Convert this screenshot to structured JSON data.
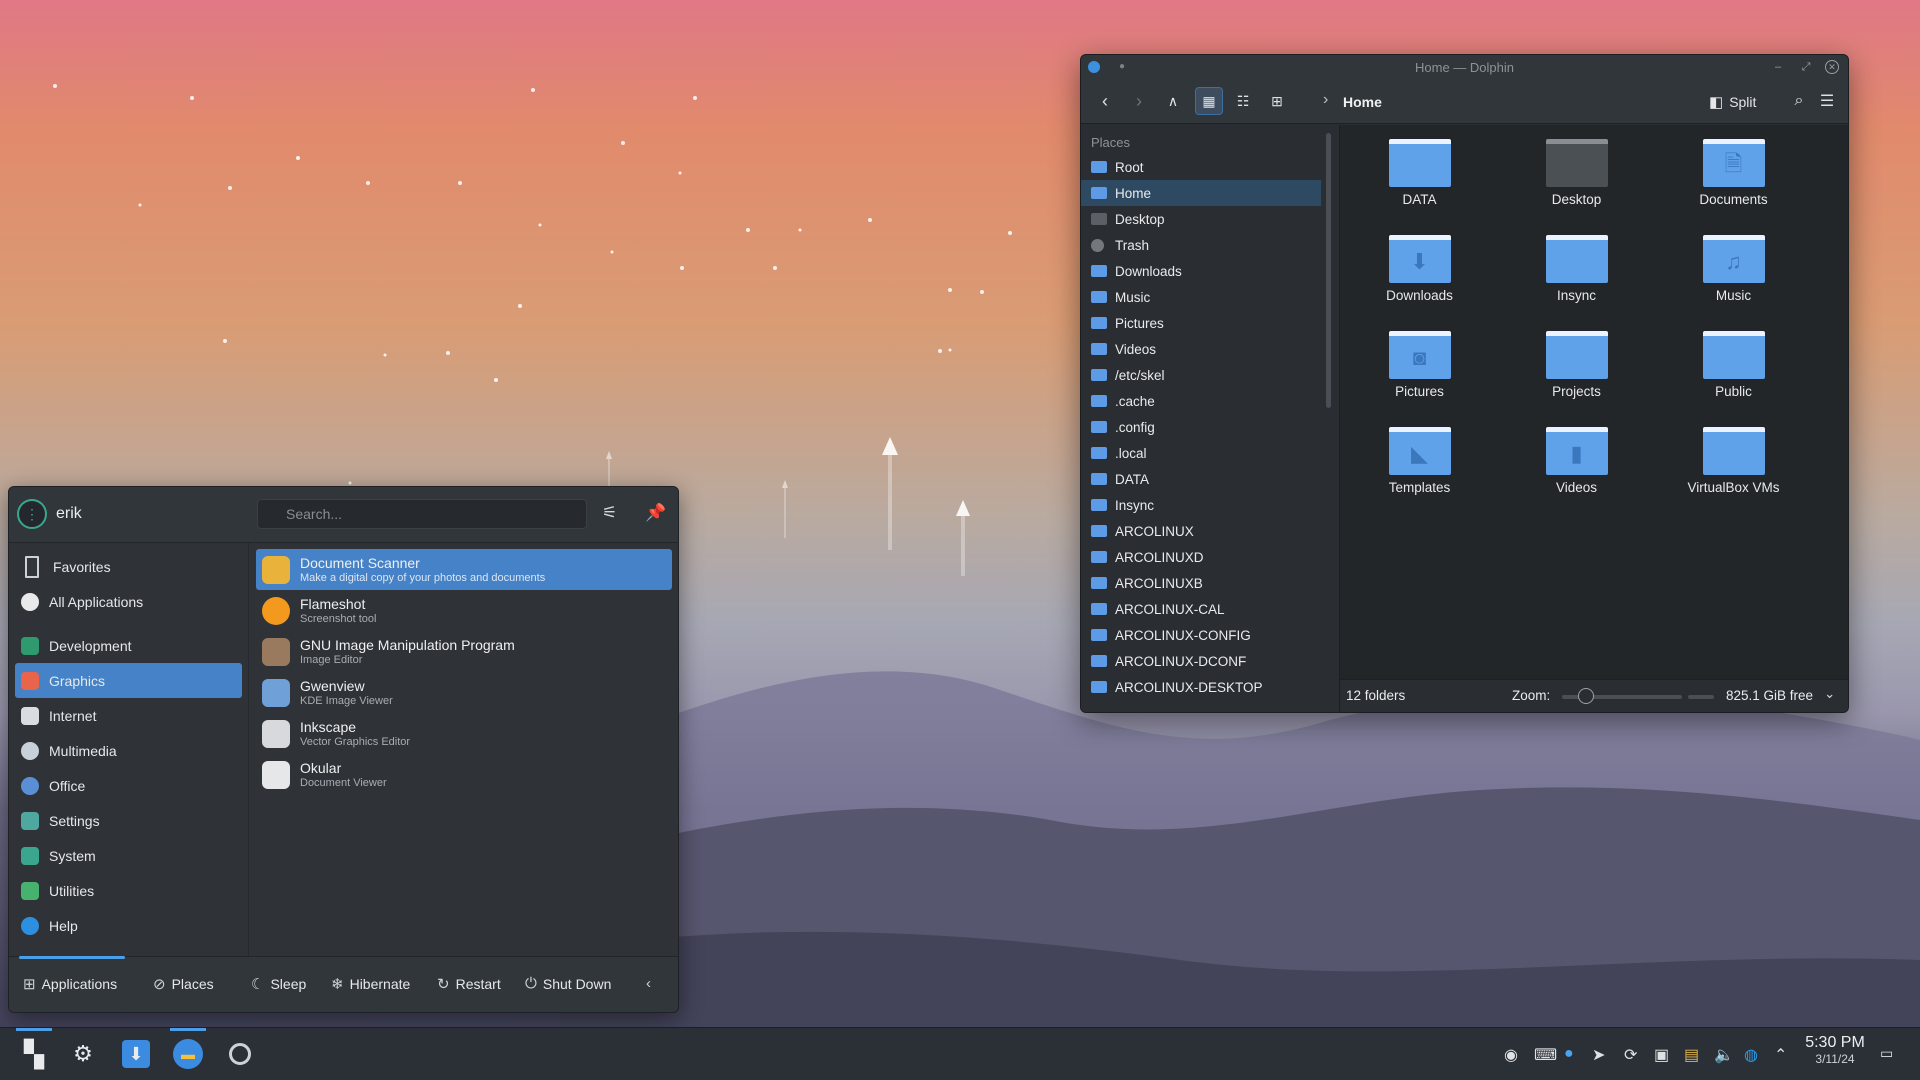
{
  "dolphin": {
    "title": "Home — Dolphin",
    "breadcrumb": "Home",
    "split_label": "Split",
    "places_header": "Places",
    "places": [
      {
        "label": "Root",
        "icon": "folder"
      },
      {
        "label": "Home",
        "icon": "folder",
        "selected": true
      },
      {
        "label": "Desktop",
        "icon": "folder-dark"
      },
      {
        "label": "Trash",
        "icon": "trash"
      },
      {
        "label": "Downloads",
        "icon": "folder"
      },
      {
        "label": "Music",
        "icon": "folder"
      },
      {
        "label": "Pictures",
        "icon": "folder"
      },
      {
        "label": "Videos",
        "icon": "folder"
      },
      {
        "label": "/etc/skel",
        "icon": "folder"
      },
      {
        "label": ".cache",
        "icon": "folder"
      },
      {
        "label": ".config",
        "icon": "folder"
      },
      {
        "label": ".local",
        "icon": "folder"
      },
      {
        "label": "DATA",
        "icon": "folder"
      },
      {
        "label": "Insync",
        "icon": "folder"
      },
      {
        "label": "ARCOLINUX",
        "icon": "folder"
      },
      {
        "label": "ARCOLINUXD",
        "icon": "folder"
      },
      {
        "label": "ARCOLINUXB",
        "icon": "folder"
      },
      {
        "label": "ARCOLINUX-CAL",
        "icon": "folder"
      },
      {
        "label": "ARCOLINUX-CONFIG",
        "icon": "folder"
      },
      {
        "label": "ARCOLINUX-DCONF",
        "icon": "folder"
      },
      {
        "label": "ARCOLINUX-DESKTOP",
        "icon": "folder"
      }
    ],
    "folders": [
      {
        "label": "DATA",
        "glyph": ""
      },
      {
        "label": "Desktop",
        "glyph": "",
        "dark": true
      },
      {
        "label": "Documents",
        "glyph": "🗎"
      },
      {
        "label": "Downloads",
        "glyph": "⬇"
      },
      {
        "label": "Insync",
        "glyph": ""
      },
      {
        "label": "Music",
        "glyph": "♫"
      },
      {
        "label": "Pictures",
        "glyph": "◙"
      },
      {
        "label": "Projects",
        "glyph": ""
      },
      {
        "label": "Public",
        "glyph": ""
      },
      {
        "label": "Templates",
        "glyph": "◣"
      },
      {
        "label": "Videos",
        "glyph": "▮"
      },
      {
        "label": "VirtualBox VMs",
        "glyph": ""
      }
    ],
    "status": {
      "count": "12 folders",
      "zoom_label": "Zoom:",
      "zoom_level": 0.15,
      "free": "825.1 GiB free"
    }
  },
  "menu": {
    "user": "erik",
    "search_placeholder": "Search...",
    "categories": [
      {
        "label": "Favorites",
        "color": "#31363b",
        "icon": "bookmark-icon"
      },
      {
        "label": "All Applications",
        "color": "#e9e9e9",
        "icon": "grid-icon"
      },
      {
        "label": "Development",
        "color": "#2e9a6e",
        "icon": "development-icon"
      },
      {
        "label": "Graphics",
        "color": "#e8644a",
        "icon": "graphics-icon",
        "selected": true
      },
      {
        "label": "Internet",
        "color": "#d9dce0",
        "icon": "internet-icon"
      },
      {
        "label": "Multimedia",
        "color": "#c8d1db",
        "icon": "multimedia-icon"
      },
      {
        "label": "Office",
        "color": "#5a8fd6",
        "icon": "office-icon"
      },
      {
        "label": "Settings",
        "color": "#4fa8a0",
        "icon": "settings-icon"
      },
      {
        "label": "System",
        "color": "#3aa68e",
        "icon": "system-icon"
      },
      {
        "label": "Utilities",
        "color": "#46b26e",
        "icon": "utilities-icon"
      },
      {
        "label": "Help",
        "color": "#2d8fe0",
        "icon": "help-icon"
      }
    ],
    "apps": [
      {
        "name": "Document Scanner",
        "desc": "Make a digital copy of your photos and documents",
        "color": "#e9b23b",
        "selected": true
      },
      {
        "name": "Flameshot",
        "desc": "Screenshot tool",
        "color": "#f39a1e"
      },
      {
        "name": "GNU Image Manipulation Program",
        "desc": "Image Editor",
        "color": "#9a7a5e"
      },
      {
        "name": "Gwenview",
        "desc": "KDE Image Viewer",
        "color": "#6fa0d8"
      },
      {
        "name": "Inkscape",
        "desc": "Vector Graphics Editor",
        "color": "#d7d9dc"
      },
      {
        "name": "Okular",
        "desc": "Document Viewer",
        "color": "#e6e7e9"
      }
    ],
    "footer": {
      "applications": "Applications",
      "places": "Places",
      "sleep": "Sleep",
      "hibernate": "Hibernate",
      "restart": "Restart",
      "shutdown": "Shut Down"
    }
  },
  "taskbar": {
    "time": "5:30 PM",
    "date": "3/11/24"
  }
}
